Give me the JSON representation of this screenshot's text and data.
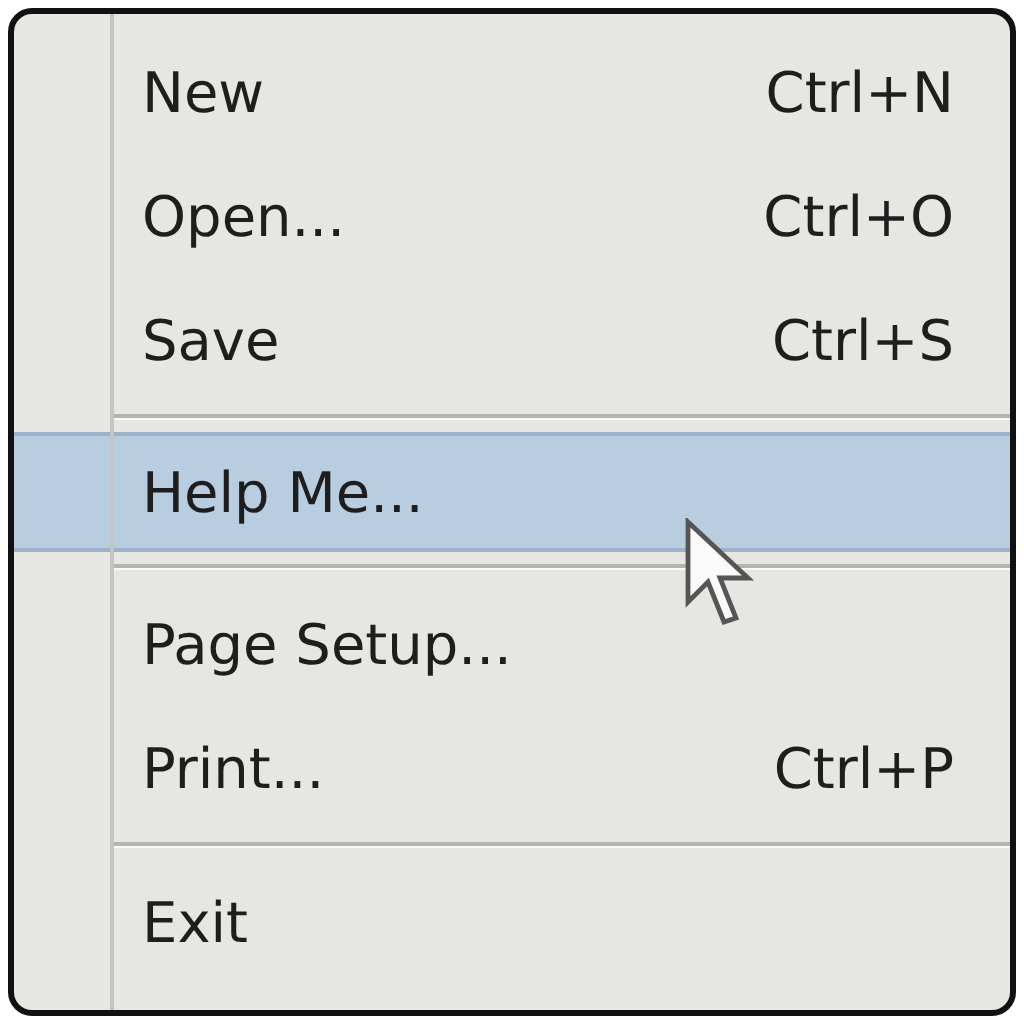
{
  "menu": {
    "items": [
      {
        "kind": "item",
        "label": "New",
        "shortcut": "Ctrl+N",
        "selected": false
      },
      {
        "kind": "item",
        "label": "Open...",
        "shortcut": "Ctrl+O",
        "selected": false
      },
      {
        "kind": "item",
        "label": "Save",
        "shortcut": "Ctrl+S",
        "selected": false
      },
      {
        "kind": "separator"
      },
      {
        "kind": "item",
        "label": "Help Me...",
        "selected": true
      },
      {
        "kind": "separator"
      },
      {
        "kind": "item",
        "label": "Page Setup...",
        "selected": false
      },
      {
        "kind": "item",
        "label": "Print...",
        "shortcut": "Ctrl+P",
        "selected": false
      },
      {
        "kind": "separator"
      },
      {
        "kind": "item",
        "label": "Exit",
        "selected": false
      }
    ]
  }
}
